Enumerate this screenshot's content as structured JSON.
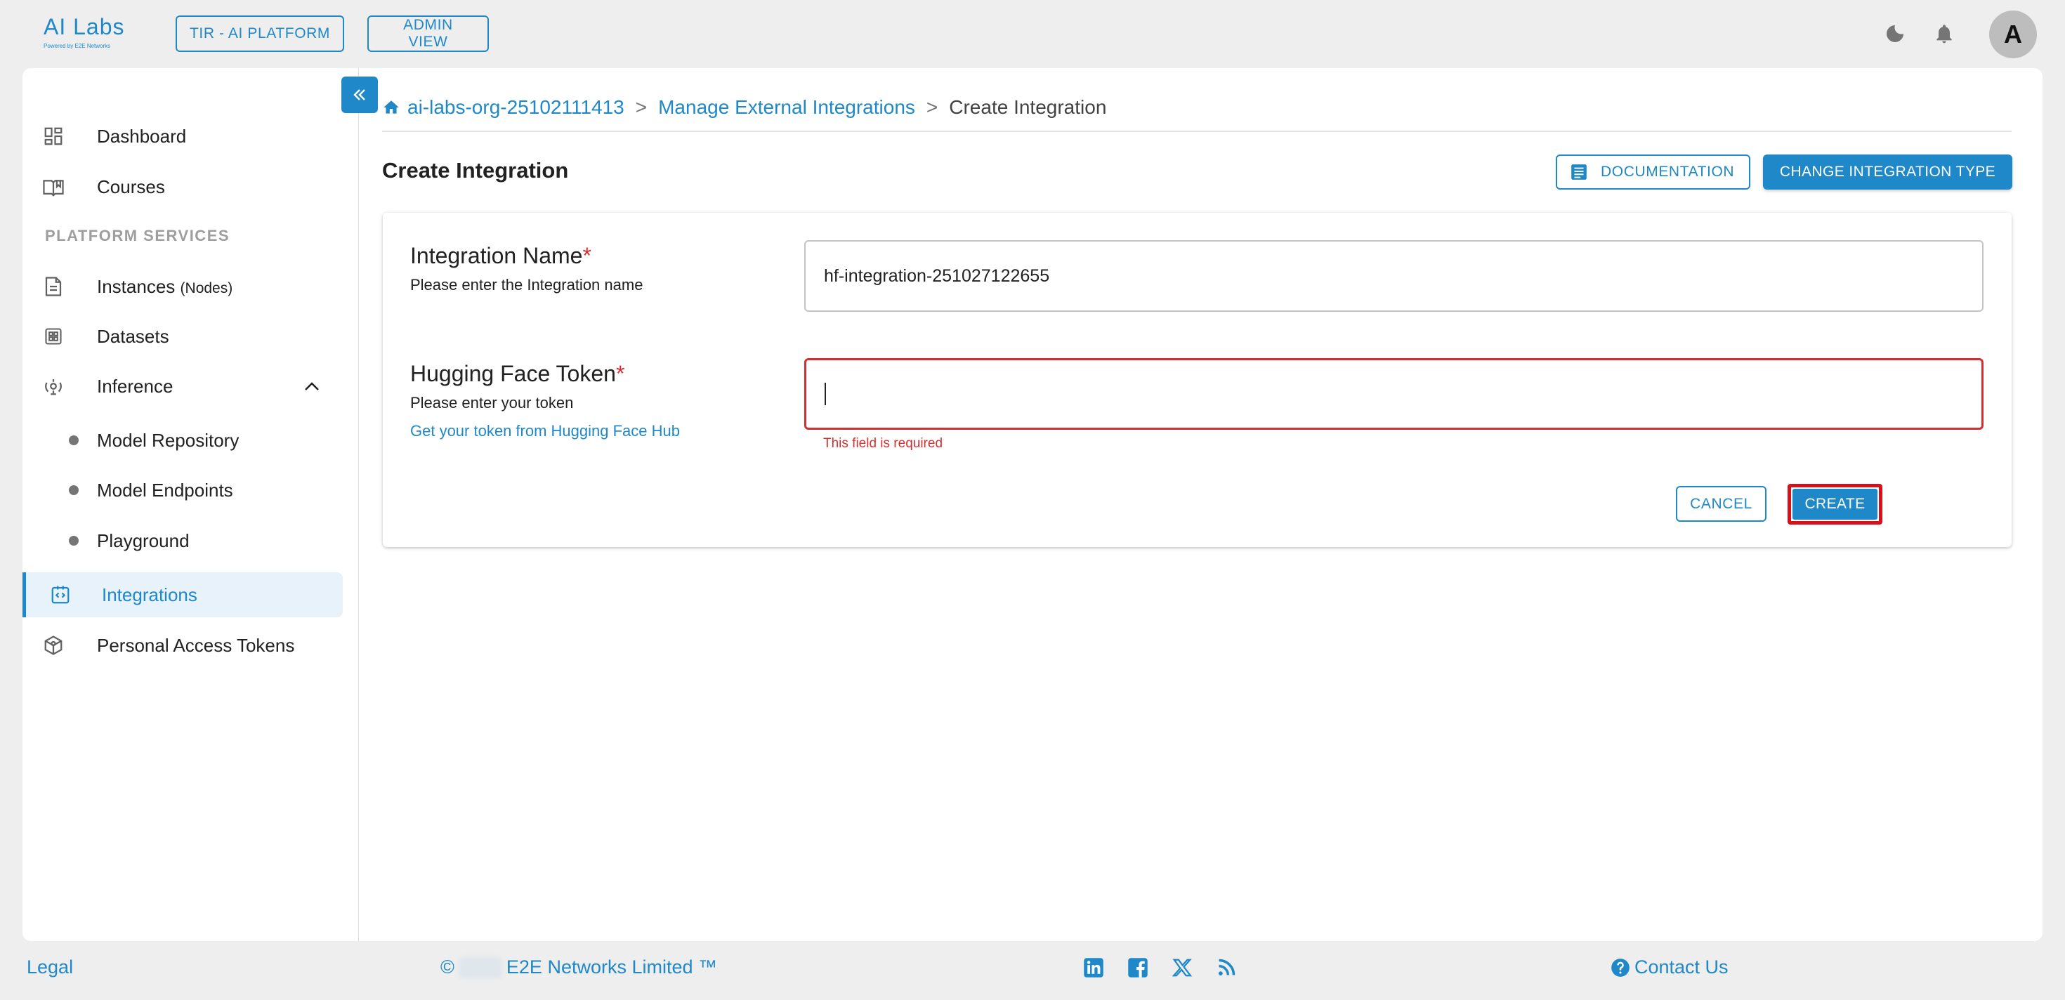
{
  "header": {
    "logo_text": "AI Labs",
    "logo_sub": "Powered by E2E Networks",
    "platform_button": "TIR - AI PLATFORM",
    "admin_button": "ADMIN VIEW",
    "avatar_initial": "A",
    "icons": [
      "moon-icon",
      "bell-icon"
    ]
  },
  "sidebar": {
    "items": [
      {
        "label": "Dashboard",
        "icon": "dashboard-icon"
      },
      {
        "label": "Courses",
        "icon": "book-icon"
      }
    ],
    "section_title": "PLATFORM SERVICES",
    "services": [
      {
        "label": "Instances",
        "suffix": "(Nodes)",
        "icon": "document-icon"
      },
      {
        "label": "Datasets",
        "icon": "grid-icon"
      },
      {
        "label": "Inference",
        "icon": "inference-icon",
        "expanded": true
      }
    ],
    "inference_children": [
      "Model Repository",
      "Model Endpoints",
      "Playground"
    ],
    "integrations": "Integrations",
    "tokens": "Personal Access Tokens"
  },
  "breadcrumb": {
    "org": "ai-labs-org-25102111413",
    "parent": "Manage External Integrations",
    "current": "Create Integration",
    "separator": ">"
  },
  "page": {
    "title": "Create Integration",
    "documentation_button": "DOCUMENTATION",
    "change_type_button": "CHANGE INTEGRATION TYPE"
  },
  "form": {
    "name_label": "Integration Name",
    "name_help": "Please enter the Integration name",
    "name_value": "hf-integration-251027122655",
    "token_label": "Hugging Face Token",
    "token_help": "Please enter your token",
    "token_link": "Get your token from Hugging Face Hub",
    "token_value": "",
    "token_error": "This field is required",
    "required_mark": "*",
    "cancel_button": "CANCEL",
    "create_button": "CREATE"
  },
  "footer": {
    "legal": "Legal",
    "copyright_symbol": "©",
    "company": "E2E Networks Limited ™",
    "contact": "Contact Us",
    "social": [
      "linkedin-icon",
      "facebook-icon",
      "x-icon",
      "rss-icon"
    ]
  },
  "colors": {
    "accent": "#1e88c8",
    "error": "#d32f2f",
    "highlight": "#d8101c",
    "background": "#eeeeee"
  }
}
